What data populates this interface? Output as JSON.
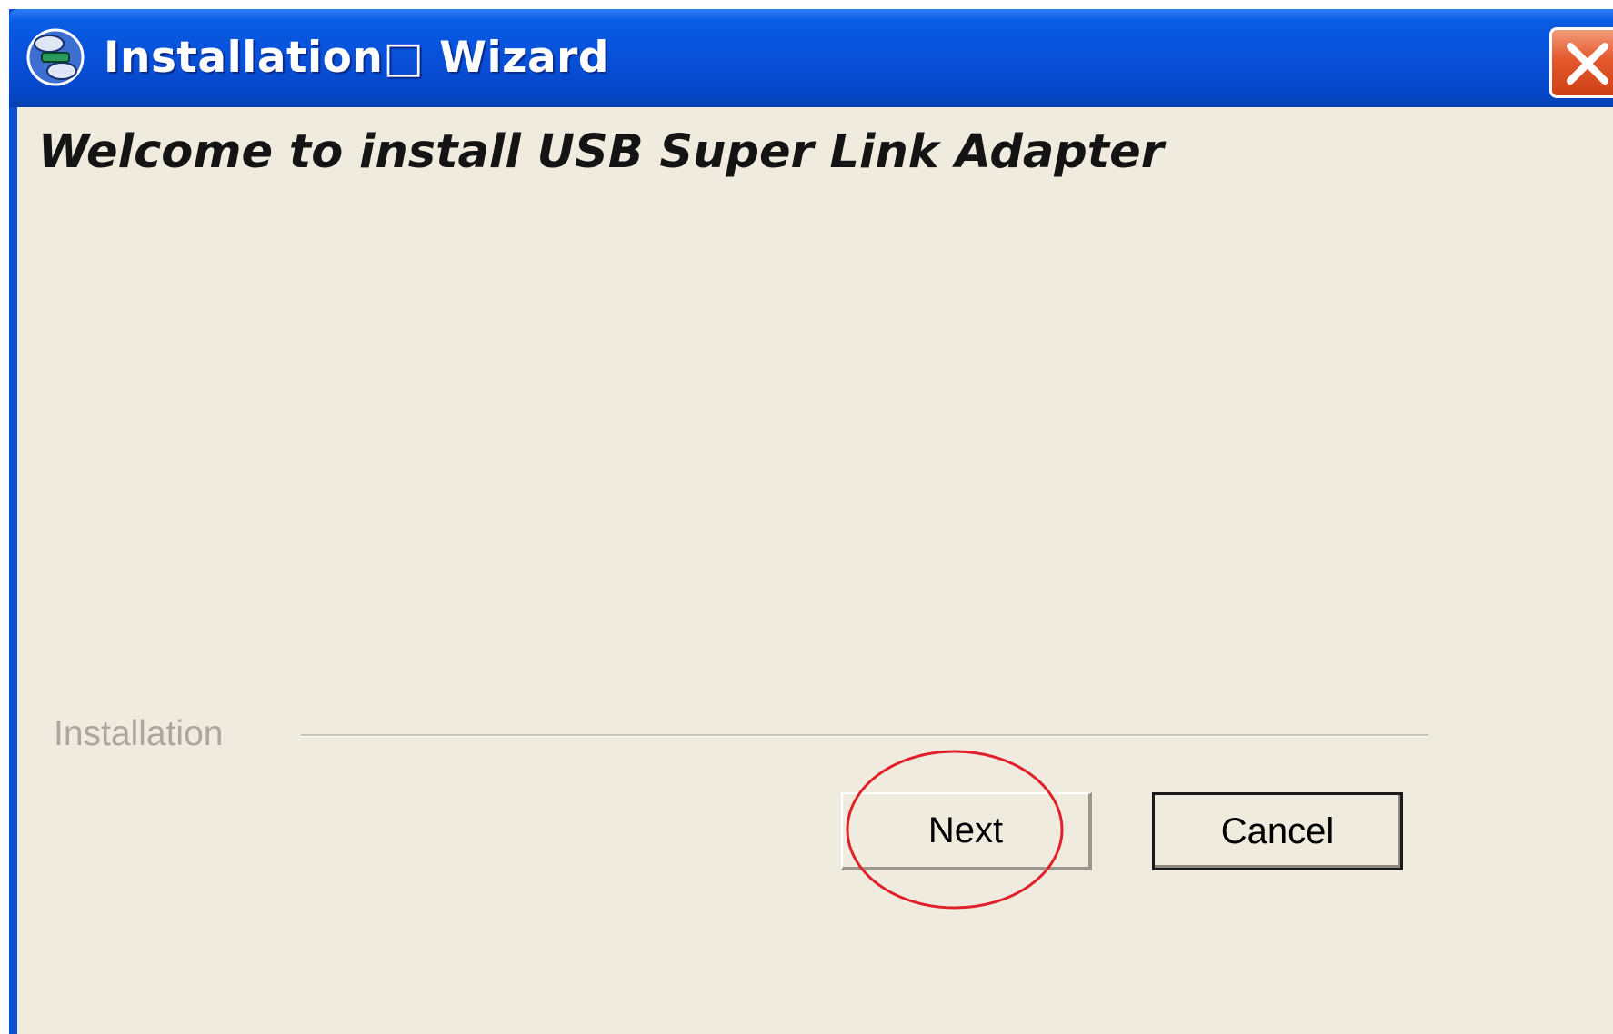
{
  "window": {
    "title": "Installation□ Wizard",
    "icon": "installer-app-icon",
    "close_icon": "close-x-icon",
    "title_bar_color": "#0a5ce4",
    "close_button_color": "#e3582e"
  },
  "content": {
    "welcome_heading": "Welcome to install USB Super Link Adapter",
    "group_label": "Installation"
  },
  "buttons": {
    "next_label": "Next",
    "cancel_label": "Cancel"
  },
  "annotation": {
    "shape": "red-circle",
    "color": "#e0202a",
    "target": "next-button"
  }
}
